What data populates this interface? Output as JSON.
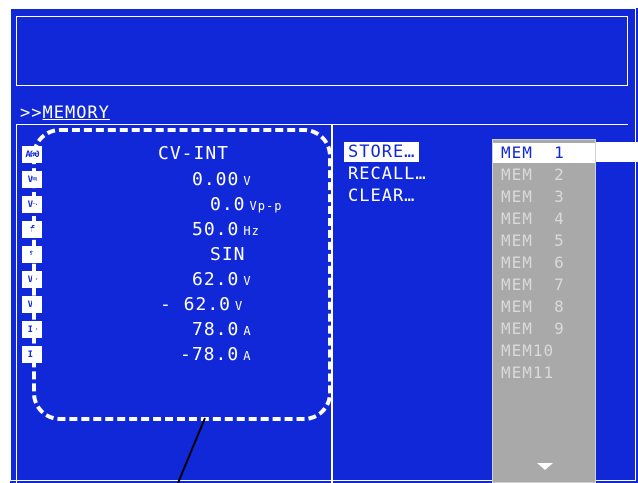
{
  "memory": {
    "title_prefix": ">>",
    "title": "MEMORY"
  },
  "settings": [
    {
      "icon": "A00",
      "value": "CV-INT",
      "unit": ""
    },
    {
      "icon": "V=",
      "value": "0.00",
      "unit": "V"
    },
    {
      "icon": "V~",
      "value": "0.0",
      "unit": "Vp-p"
    },
    {
      "icon": "f",
      "value": "50.0",
      "unit": "Hz"
    },
    {
      "icon": "%",
      "value": "SIN",
      "unit": ""
    },
    {
      "icon": "V+",
      "value": "62.0",
      "unit": "V"
    },
    {
      "icon": "V-",
      "value": "- 62.0",
      "unit": "V"
    },
    {
      "icon": "I+",
      "value": "78.0",
      "unit": "A"
    },
    {
      "icon": "I-",
      "value": "-78.0",
      "unit": "A"
    }
  ],
  "menu": {
    "store": "STORE…",
    "recall": "RECALL…",
    "clear": "CLEAR…"
  },
  "memory_slots": [
    "MEM  1",
    "MEM  2",
    "MEM  3",
    "MEM  4",
    "MEM  5",
    "MEM  6",
    "MEM  7",
    "MEM  8",
    "MEM  9",
    "MEM10",
    "MEM11"
  ],
  "colors": {
    "screen": "#1028d8",
    "text": "#ffffff",
    "dropdown": "#a9a9a9"
  }
}
